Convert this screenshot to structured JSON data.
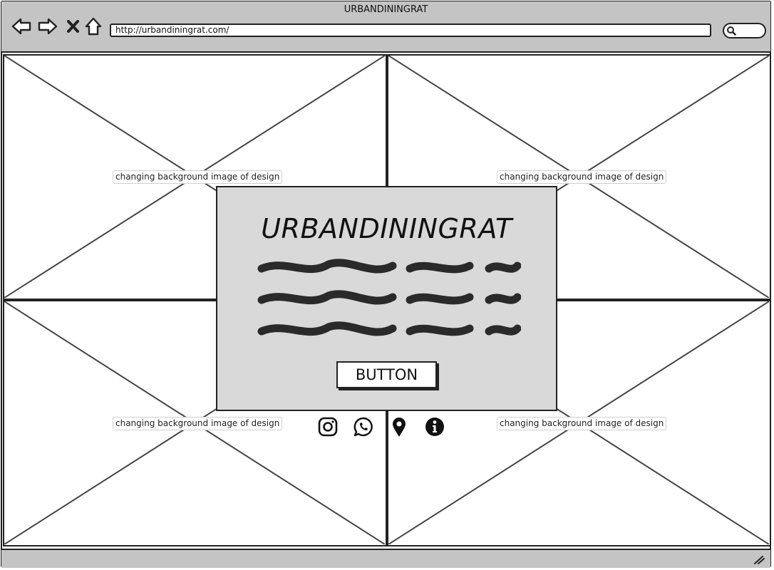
{
  "window": {
    "title": "URBANDININGRAT"
  },
  "toolbar": {
    "back_icon": "arrow-left-icon",
    "forward_icon": "arrow-right-icon",
    "close_icon": "x-icon",
    "home_icon": "home-icon",
    "url": "http://urbandiningrat.com/",
    "search_icon": "search-icon"
  },
  "panels": [
    {
      "label": "changing background image of design"
    },
    {
      "label": "changing background image of design"
    },
    {
      "label": "changing background image of design"
    },
    {
      "label": "changing background image of design"
    }
  ],
  "card": {
    "title": "URBANDININGRAT",
    "button_label": "BUTTON"
  },
  "social_icons": [
    "instagram-icon",
    "whatsapp-icon",
    "map-pin-icon",
    "info-icon"
  ],
  "colors": {
    "chrome": "#c4c4c4",
    "card": "#d9d9d9",
    "ink": "#222222"
  }
}
